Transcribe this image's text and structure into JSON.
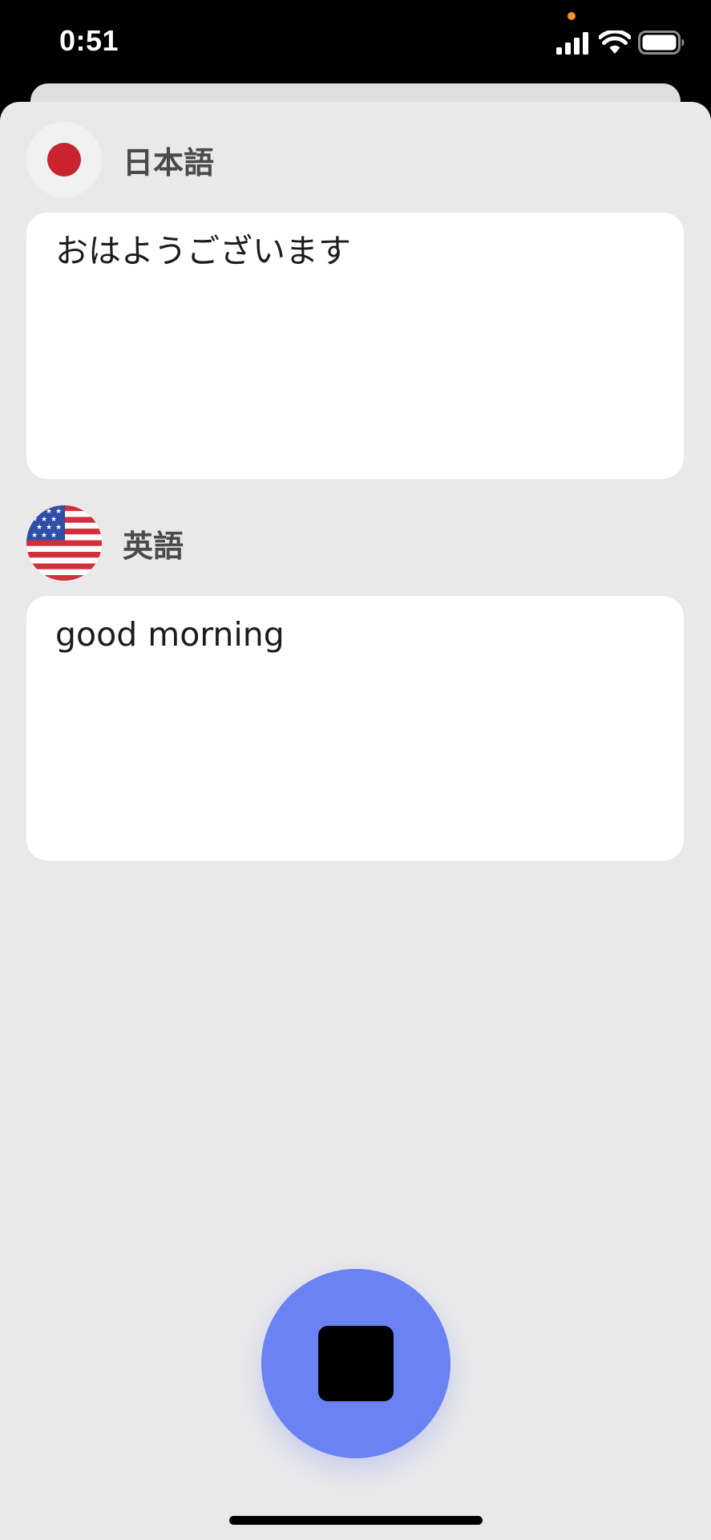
{
  "status_bar": {
    "time": "0:51",
    "privacy_dot_color": "#f0932b"
  },
  "source": {
    "flag_icon": "japan-flag-icon",
    "language": "日本語",
    "text": "おはようございます"
  },
  "target": {
    "flag_icon": "us-flag-icon",
    "language": "英語",
    "text": "good morning"
  },
  "controls": {
    "stop_icon": "stop-icon",
    "accent_color": "#6b82f2"
  },
  "colors": {
    "sheet_background": "#e9e9ea",
    "card_background": "#ffffff",
    "japan_red": "#c8232e"
  }
}
